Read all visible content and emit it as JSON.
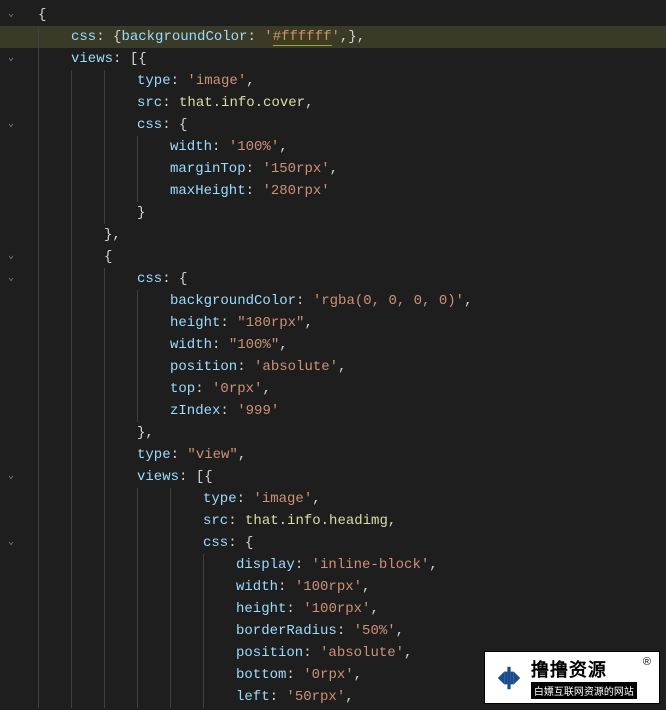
{
  "lines": [
    {
      "guides": 0,
      "fold": true,
      "indent": 0,
      "tokens": [
        {
          "t": "{",
          "c": "p"
        }
      ]
    },
    {
      "guides": 1,
      "highlight": true,
      "indent": 1,
      "tokens": [
        {
          "t": "css",
          "c": "k"
        },
        {
          "t": ": {",
          "c": "p"
        },
        {
          "t": "backgroundColor",
          "c": "k"
        },
        {
          "t": ": ",
          "c": "p"
        },
        {
          "t": "'",
          "c": "s"
        },
        {
          "t": "#ffffff",
          "c": "s",
          "sel": true
        },
        {
          "t": "'",
          "c": "s"
        },
        {
          "t": ",},",
          "c": "p"
        }
      ]
    },
    {
      "guides": 1,
      "fold": true,
      "indent": 1,
      "tokens": [
        {
          "t": "views",
          "c": "k"
        },
        {
          "t": ": [{",
          "c": "p"
        }
      ]
    },
    {
      "guides": 3,
      "indent": 3,
      "tokens": [
        {
          "t": "type",
          "c": "k"
        },
        {
          "t": ": ",
          "c": "p"
        },
        {
          "t": "'image'",
          "c": "s"
        },
        {
          "t": ",",
          "c": "p"
        }
      ]
    },
    {
      "guides": 3,
      "indent": 3,
      "tokens": [
        {
          "t": "src",
          "c": "k"
        },
        {
          "t": ": ",
          "c": "p"
        },
        {
          "t": "that.info.cover",
          "c": "d"
        },
        {
          "t": ",",
          "c": "p"
        }
      ]
    },
    {
      "guides": 3,
      "fold": true,
      "indent": 3,
      "tokens": [
        {
          "t": "css",
          "c": "k"
        },
        {
          "t": ": {",
          "c": "p"
        }
      ]
    },
    {
      "guides": 4,
      "indent": 4,
      "tokens": [
        {
          "t": "width",
          "c": "k"
        },
        {
          "t": ": ",
          "c": "p"
        },
        {
          "t": "'100%'",
          "c": "s"
        },
        {
          "t": ",",
          "c": "p"
        }
      ]
    },
    {
      "guides": 4,
      "indent": 4,
      "tokens": [
        {
          "t": "marginTop",
          "c": "k"
        },
        {
          "t": ": ",
          "c": "p"
        },
        {
          "t": "'150rpx'",
          "c": "s"
        },
        {
          "t": ",",
          "c": "p"
        }
      ]
    },
    {
      "guides": 4,
      "indent": 4,
      "tokens": [
        {
          "t": "maxHeight",
          "c": "k"
        },
        {
          "t": ": ",
          "c": "p"
        },
        {
          "t": "'280rpx'",
          "c": "s"
        }
      ]
    },
    {
      "guides": 3,
      "indent": 3,
      "tokens": [
        {
          "t": "}",
          "c": "p"
        }
      ]
    },
    {
      "guides": 2,
      "indent": 2,
      "tokens": [
        {
          "t": "},",
          "c": "p"
        }
      ]
    },
    {
      "guides": 2,
      "fold": true,
      "indent": 2,
      "tokens": [
        {
          "t": "{",
          "c": "p"
        }
      ]
    },
    {
      "guides": 3,
      "fold": true,
      "indent": 3,
      "tokens": [
        {
          "t": "css",
          "c": "k"
        },
        {
          "t": ": {",
          "c": "p"
        }
      ]
    },
    {
      "guides": 4,
      "indent": 4,
      "tokens": [
        {
          "t": "backgroundColor",
          "c": "k"
        },
        {
          "t": ": ",
          "c": "p"
        },
        {
          "t": "'rgba(0, 0, 0, 0)'",
          "c": "s"
        },
        {
          "t": ",",
          "c": "p"
        }
      ]
    },
    {
      "guides": 4,
      "indent": 4,
      "tokens": [
        {
          "t": "height",
          "c": "k"
        },
        {
          "t": ": ",
          "c": "p"
        },
        {
          "t": "\"180rpx\"",
          "c": "s"
        },
        {
          "t": ",",
          "c": "p"
        }
      ]
    },
    {
      "guides": 4,
      "indent": 4,
      "tokens": [
        {
          "t": "width",
          "c": "k"
        },
        {
          "t": ": ",
          "c": "p"
        },
        {
          "t": "\"100%\"",
          "c": "s"
        },
        {
          "t": ",",
          "c": "p"
        }
      ]
    },
    {
      "guides": 4,
      "indent": 4,
      "tokens": [
        {
          "t": "position",
          "c": "k"
        },
        {
          "t": ": ",
          "c": "p"
        },
        {
          "t": "'absolute'",
          "c": "s"
        },
        {
          "t": ",",
          "c": "p"
        }
      ]
    },
    {
      "guides": 4,
      "indent": 4,
      "tokens": [
        {
          "t": "top",
          "c": "k"
        },
        {
          "t": ": ",
          "c": "p"
        },
        {
          "t": "'0rpx'",
          "c": "s"
        },
        {
          "t": ",",
          "c": "p"
        }
      ]
    },
    {
      "guides": 4,
      "indent": 4,
      "tokens": [
        {
          "t": "zIndex",
          "c": "k"
        },
        {
          "t": ": ",
          "c": "p"
        },
        {
          "t": "'999'",
          "c": "s"
        }
      ]
    },
    {
      "guides": 3,
      "indent": 3,
      "tokens": [
        {
          "t": "},",
          "c": "p"
        }
      ]
    },
    {
      "guides": 3,
      "indent": 3,
      "tokens": [
        {
          "t": "type",
          "c": "k"
        },
        {
          "t": ": ",
          "c": "p"
        },
        {
          "t": "\"view\"",
          "c": "s"
        },
        {
          "t": ",",
          "c": "p"
        }
      ]
    },
    {
      "guides": 3,
      "fold": true,
      "indent": 3,
      "tokens": [
        {
          "t": "views",
          "c": "k"
        },
        {
          "t": ": [{",
          "c": "p"
        }
      ]
    },
    {
      "guides": 5,
      "indent": 5,
      "tokens": [
        {
          "t": "type",
          "c": "k"
        },
        {
          "t": ": ",
          "c": "p"
        },
        {
          "t": "'image'",
          "c": "s"
        },
        {
          "t": ",",
          "c": "p"
        }
      ]
    },
    {
      "guides": 5,
      "indent": 5,
      "tokens": [
        {
          "t": "src",
          "c": "k"
        },
        {
          "t": ": ",
          "c": "p"
        },
        {
          "t": "that.info.headimg",
          "c": "d"
        },
        {
          "t": ",",
          "c": "p"
        }
      ]
    },
    {
      "guides": 5,
      "fold": true,
      "indent": 5,
      "tokens": [
        {
          "t": "css",
          "c": "k"
        },
        {
          "t": ": {",
          "c": "p"
        }
      ]
    },
    {
      "guides": 6,
      "indent": 6,
      "tokens": [
        {
          "t": "display",
          "c": "k"
        },
        {
          "t": ": ",
          "c": "p"
        },
        {
          "t": "'inline-block'",
          "c": "s"
        },
        {
          "t": ",",
          "c": "p"
        }
      ]
    },
    {
      "guides": 6,
      "indent": 6,
      "tokens": [
        {
          "t": "width",
          "c": "k"
        },
        {
          "t": ": ",
          "c": "p"
        },
        {
          "t": "'100rpx'",
          "c": "s"
        },
        {
          "t": ",",
          "c": "p"
        }
      ]
    },
    {
      "guides": 6,
      "indent": 6,
      "tokens": [
        {
          "t": "height",
          "c": "k"
        },
        {
          "t": ": ",
          "c": "p"
        },
        {
          "t": "'100rpx'",
          "c": "s"
        },
        {
          "t": ",",
          "c": "p"
        }
      ]
    },
    {
      "guides": 6,
      "indent": 6,
      "tokens": [
        {
          "t": "borderRadius",
          "c": "k"
        },
        {
          "t": ": ",
          "c": "p"
        },
        {
          "t": "'50%'",
          "c": "s"
        },
        {
          "t": ",",
          "c": "p"
        }
      ]
    },
    {
      "guides": 6,
      "indent": 6,
      "tokens": [
        {
          "t": "position",
          "c": "k"
        },
        {
          "t": ": ",
          "c": "p"
        },
        {
          "t": "'absolute'",
          "c": "s"
        },
        {
          "t": ",",
          "c": "p"
        }
      ]
    },
    {
      "guides": 6,
      "indent": 6,
      "tokens": [
        {
          "t": "bottom",
          "c": "k"
        },
        {
          "t": ": ",
          "c": "p"
        },
        {
          "t": "'0rpx'",
          "c": "s"
        },
        {
          "t": ",",
          "c": "p"
        }
      ]
    },
    {
      "guides": 6,
      "indent": 6,
      "tokens": [
        {
          "t": "left",
          "c": "k"
        },
        {
          "t": ": ",
          "c": "p"
        },
        {
          "t": "'50rpx'",
          "c": "s"
        },
        {
          "t": ",",
          "c": "p"
        }
      ]
    }
  ],
  "watermark": {
    "main": "撸撸资源",
    "sub": "白嫖互联网资源的网站",
    "reg": "®"
  }
}
